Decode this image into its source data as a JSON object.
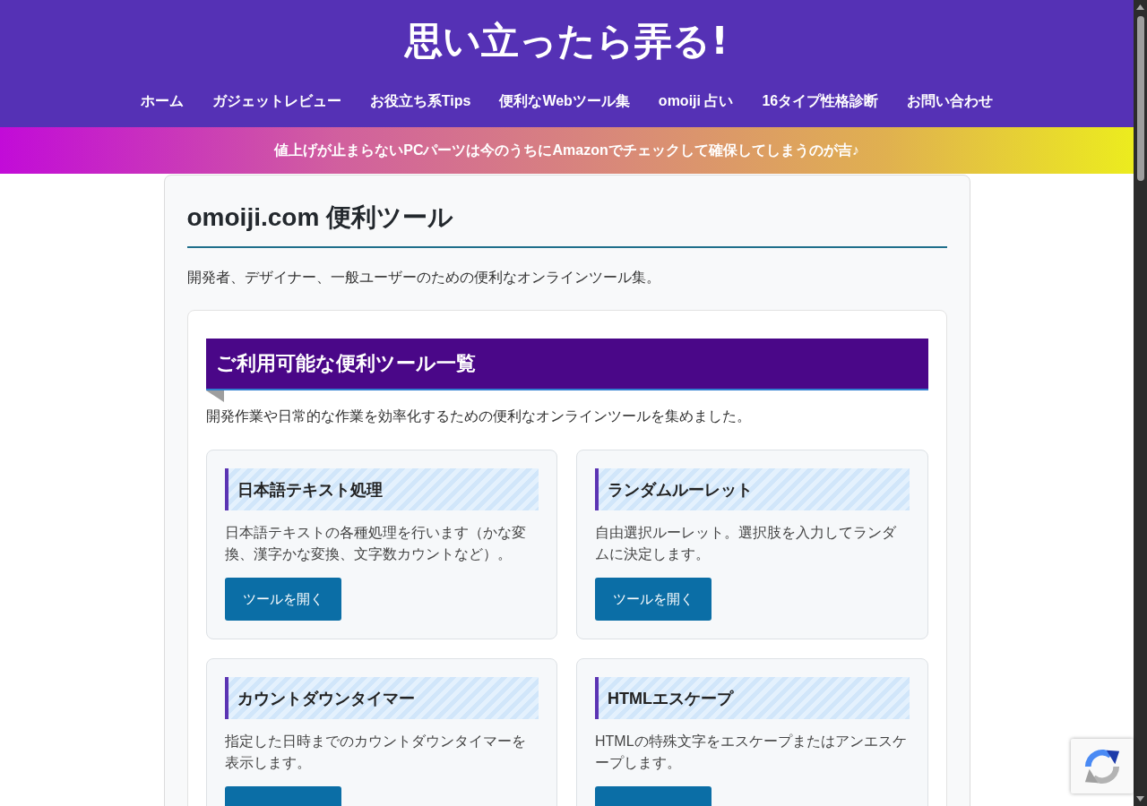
{
  "header": {
    "site_title": "思い立ったら弄る!",
    "nav": [
      "ホーム",
      "ガジェットレビュー",
      "お役立ち系Tips",
      "便利なWebツール集",
      "omoiji 占い",
      "16タイプ性格診断",
      "お問い合わせ"
    ]
  },
  "banner": {
    "text": "値上げが止まらないPCパーツは今のうちにAmazonでチェックして確保してしまうのが吉♪"
  },
  "page": {
    "title": "omoiji.com 便利ツール",
    "description": "開発者、デザイナー、一般ユーザーのための便利なオンラインツール集。"
  },
  "tool_section": {
    "heading": "ご利用可能な便利ツール一覧",
    "intro": "開発作業や日常的な作業を効率化するための便利なオンラインツールを集めました。",
    "tools": [
      {
        "name": "日本語テキスト処理",
        "description": "日本語テキストの各種処理を行います（かな変換、漢字かな変換、文字数カウントなど）。",
        "button": "ツールを開く"
      },
      {
        "name": "ランダムルーレット",
        "description": "自由選択ルーレット。選択肢を入力してランダムに決定します。",
        "button": "ツールを開く"
      },
      {
        "name": "カウントダウンタイマー",
        "description": "指定した日時までのカウントダウンタイマーを表示します。"
      },
      {
        "name": "HTMLエスケープ",
        "description": "HTMLの特殊文字をエスケープまたはアンエスケープします。"
      }
    ]
  }
}
